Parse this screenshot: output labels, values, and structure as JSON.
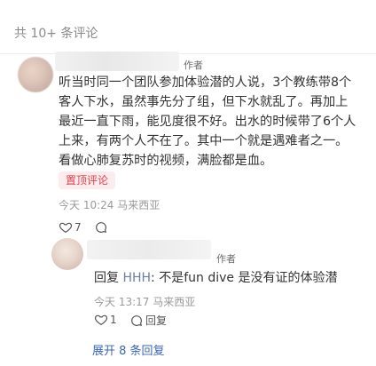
{
  "header": {
    "comment_count_label": "共 10+ 条评论"
  },
  "comment": {
    "author_tag": "作者",
    "text": "听当时同一个团队参加体验潜的人说，3个教练带8个客人下水，虽然事先分了组，但下水就乱了。再加上最近一直下雨，能见度很不好。出水的时候带了6个人上来，有两个人不在了。其中一个就是遇难者之一。看做心肺复苏时的视频，满脸都是血。",
    "pinned_label": "置顶评论",
    "meta": "今天 10:24 马来西亚",
    "likes": "7",
    "reply_icon": "comment-bubble-icon"
  },
  "reply": {
    "author_tag": "作者",
    "prefix": "回复",
    "target": "HHH",
    "text": ": 不是fun dive 是没有证的体验潜",
    "meta": "今天 13:17 马来西亚",
    "likes": "1",
    "reply_label": "回复"
  },
  "expand_label": "展开 8 条回复",
  "colors": {
    "accent_red": "#e0424a",
    "link_blue": "#3b66b5",
    "meta_gray": "#9a9a9a"
  }
}
